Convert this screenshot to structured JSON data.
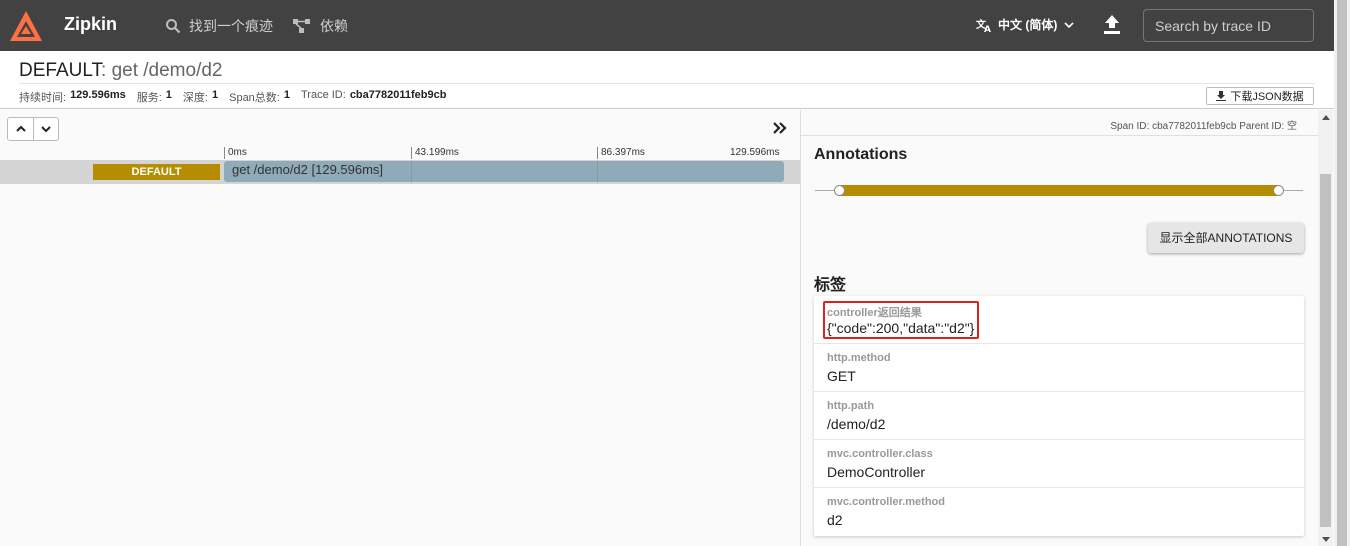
{
  "app": {
    "brand": "Zipkin",
    "nav_find": "找到一个痕迹",
    "nav_deps": "依赖",
    "language": "中文 (简体)",
    "search_placeholder": "Search by trace ID",
    "accent": "#fe6f41"
  },
  "trace": {
    "service": "DEFAULT",
    "span_name": ": get /demo/d2",
    "meta": [
      {
        "label": "持续时间:",
        "value": "129.596ms"
      },
      {
        "label": "服务:",
        "value": "1"
      },
      {
        "label": "深度:",
        "value": "1"
      },
      {
        "label": "Span总数:",
        "value": "1"
      },
      {
        "label": "Trace ID:",
        "value": "cba7782011feb9cb"
      }
    ],
    "download_label": "下载JSON数据"
  },
  "timeline": {
    "ticks": [
      "0ms",
      "43.199ms",
      "86.397ms",
      "129.596ms"
    ],
    "span": {
      "service_badge": "DEFAULT",
      "label": "get /demo/d2 [129.596ms]",
      "badge_color": "#b68d00",
      "bar_color": "#8faab8"
    }
  },
  "detail": {
    "span_ids": "Span ID: cba7782011feb9cb   Parent ID: 空",
    "annotations_title": "Annotations",
    "show_all_label": "显示全部ANNOTATIONS",
    "tags_title": "标签",
    "tags": [
      {
        "key": "controller返回结果",
        "value": "{\"code\":200,\"data\":\"d2\"}"
      },
      {
        "key": "http.method",
        "value": "GET"
      },
      {
        "key": "http.path",
        "value": "/demo/d2"
      },
      {
        "key": "mvc.controller.class",
        "value": "DemoController"
      },
      {
        "key": "mvc.controller.method",
        "value": "d2"
      }
    ]
  }
}
